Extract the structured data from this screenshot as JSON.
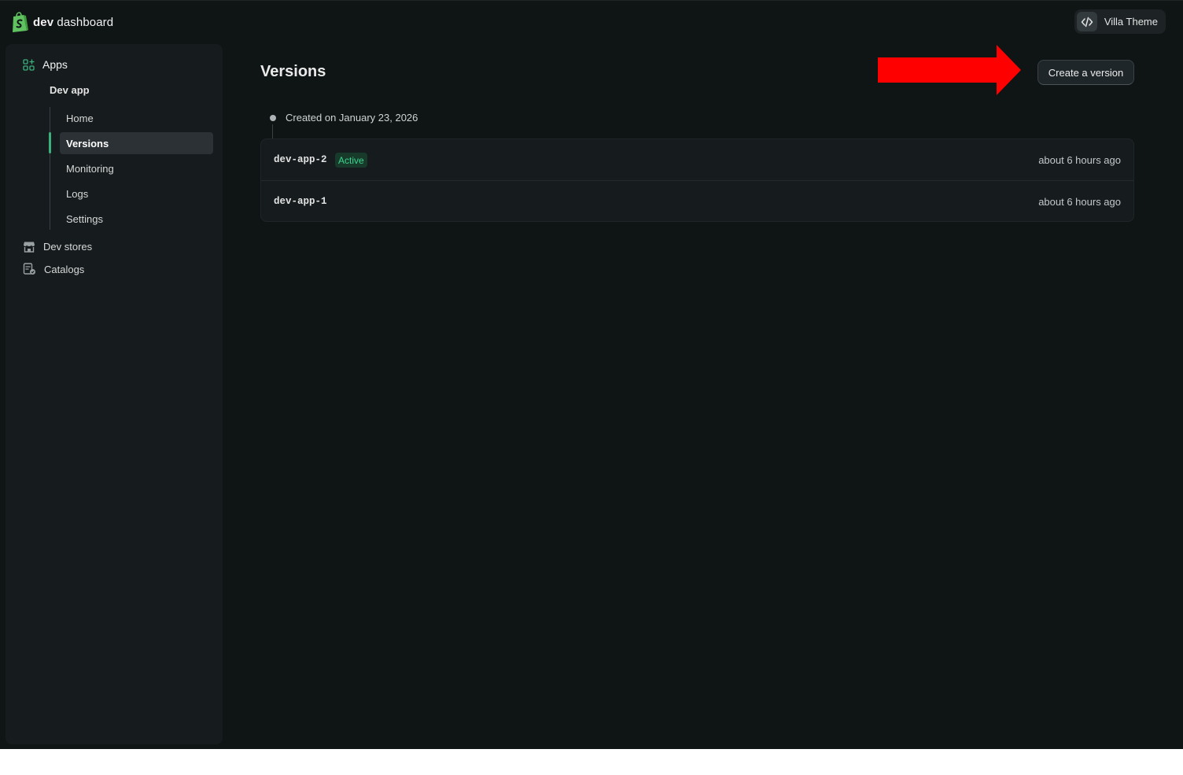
{
  "brand": {
    "name_bold": "dev",
    "name_rest": " dashboard",
    "logo_icon": "shopify-bag-icon",
    "logo_color": "#5fc15f"
  },
  "theme_switch": {
    "label": "Villa Theme",
    "icon": "code-brackets-icon"
  },
  "sidebar": {
    "apps_label": "Apps",
    "apps_icon": "apps-grid-icon",
    "app_name": "Dev app",
    "sub_items": [
      {
        "label": "Home",
        "active": false
      },
      {
        "label": "Versions",
        "active": true
      },
      {
        "label": "Monitoring",
        "active": false
      },
      {
        "label": "Logs",
        "active": false
      },
      {
        "label": "Settings",
        "active": false
      }
    ],
    "bottom_items": [
      {
        "label": "Dev stores",
        "icon": "store-icon"
      },
      {
        "label": "Catalogs",
        "icon": "catalog-icon"
      }
    ],
    "accent_color": "#3bb07c"
  },
  "main": {
    "title": "Versions",
    "create_button_label": "Create a version",
    "created_on": "Created on January 23, 2026",
    "versions": [
      {
        "name": "dev-app-2",
        "badge": "Active",
        "time": "about 6 hours ago"
      },
      {
        "name": "dev-app-1",
        "badge": "",
        "time": "about 6 hours ago"
      }
    ]
  },
  "annotation": {
    "arrow_color": "#ff0000"
  }
}
